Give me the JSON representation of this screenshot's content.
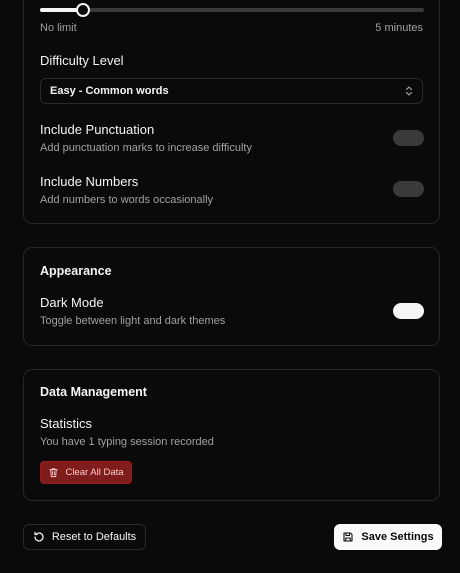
{
  "typing": {
    "time_limit_slider": {
      "value_fraction": 0.11,
      "min_label": "No limit",
      "max_label": "5 minutes"
    },
    "difficulty": {
      "label": "Difficulty Level",
      "selected": "Easy - Common words"
    },
    "punctuation": {
      "label": "Include Punctuation",
      "description": "Add punctuation marks to increase difficulty",
      "enabled": false
    },
    "numbers": {
      "label": "Include Numbers",
      "description": "Add numbers to words occasionally",
      "enabled": false
    }
  },
  "appearance": {
    "title": "Appearance",
    "dark_mode": {
      "label": "Dark Mode",
      "description": "Toggle between light and dark themes",
      "enabled": true
    }
  },
  "data_management": {
    "title": "Data Management",
    "statistics_label": "Statistics",
    "statistics_text": "You have 1 typing session recorded",
    "clear_button": "Clear All Data"
  },
  "footer": {
    "reset_button": "Reset to Defaults",
    "save_button": "Save Settings"
  },
  "icons": {
    "select_chevron": "chevrons-up-down-icon",
    "clear": "trash-icon",
    "reset": "rotate-ccw-icon",
    "save": "save-icon"
  },
  "colors": {
    "background": "#0a0a0a",
    "danger": "#7f1d1d",
    "primary_button": "#fafafa"
  }
}
